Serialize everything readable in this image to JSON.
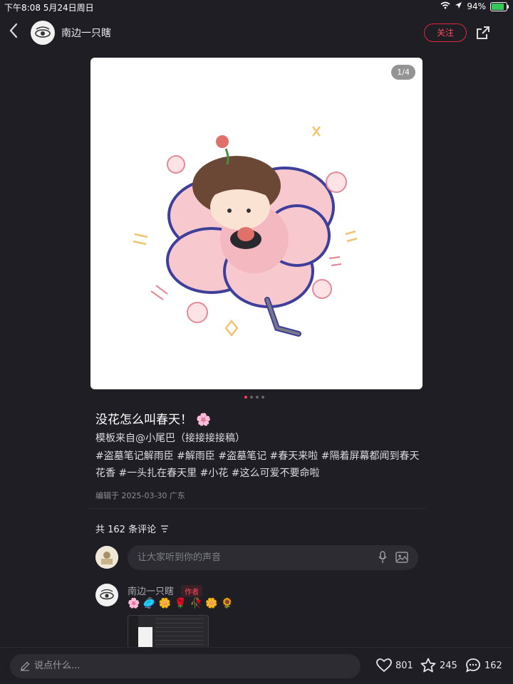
{
  "status": {
    "time_date": "下午8:08   5月24日周日",
    "battery": "94%",
    "battery_level": 0.94
  },
  "header": {
    "author": "南边一只瞎",
    "follow_label": "关注",
    "back_icon": "chevron-left-icon",
    "share_icon": "share-icon"
  },
  "image": {
    "page_indicator": "1/4",
    "current_page": 1,
    "total_pages": 4
  },
  "post": {
    "title": "没花怎么叫春天！ 🌸",
    "body": "模板来自@小尾巴（接接接接稿）\n#盗墓笔记解雨臣 #解雨臣 #盗墓笔记 #春天来啦 #隔着屏幕都闻到春天花香 #一头扎在春天里 #小花 #这么可爱不要命啦",
    "meta": "编辑于 2025-03-30 广东"
  },
  "comments": {
    "count_label": "共 162 条评论",
    "input_placeholder": "让大家听到你的声音",
    "first": {
      "name": "南边一只瞎",
      "badge": "作者",
      "emojis": "🌸 🥏 🌼 🌹 🥀 🌼 🌻"
    }
  },
  "bottom": {
    "say_placeholder": "说点什么...",
    "likes": "801",
    "favorites": "245",
    "comments": "162"
  },
  "colors": {
    "accent": "#ff4a5d",
    "background": "#1f1e25"
  }
}
